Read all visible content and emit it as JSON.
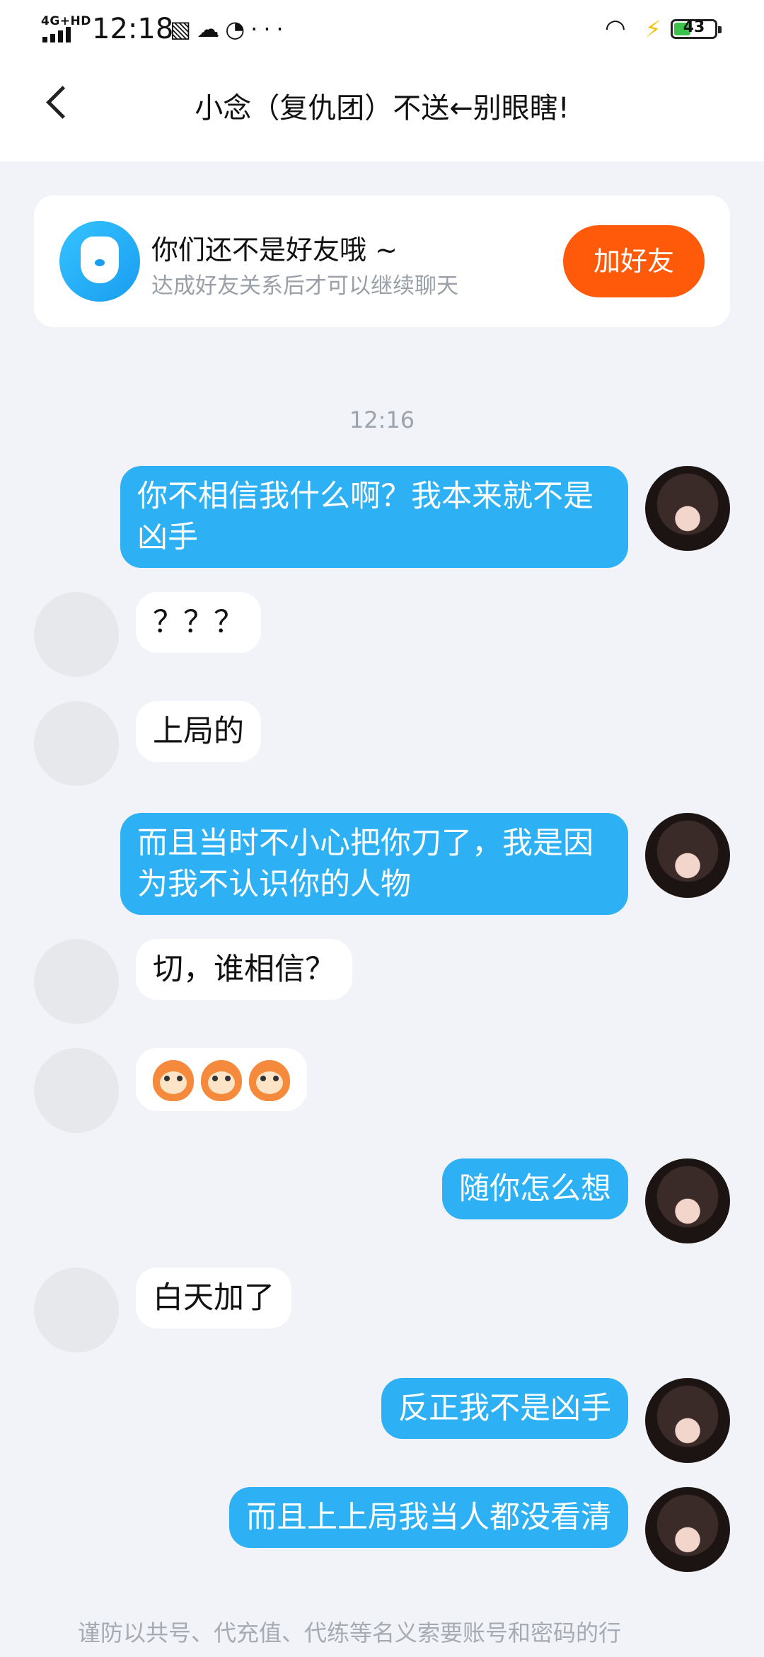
{
  "status_bar": {
    "network": "4G+HD",
    "time": "12:18",
    "icons": [
      "screenshot-icon",
      "cloud-icon",
      "compass-icon",
      "more-dots-icon"
    ],
    "icon_glyphs": "▧☁◔···",
    "battery": "43",
    "battery_level_percent": 43
  },
  "header": {
    "title": "小念（复仇团）不送←别眼瞎!"
  },
  "friend_card": {
    "headline": "你们还不是好友哦 ~",
    "subtext": "达成好友关系后才可以继续聊天",
    "button": "加好友"
  },
  "timestamp": "12:16",
  "messages": [
    {
      "side": "me",
      "text": "你不相信我什么啊？我本来就不是凶手"
    },
    {
      "side": "peer",
      "text": "？？？"
    },
    {
      "side": "peer",
      "text": "上局的"
    },
    {
      "side": "me",
      "text": "而且当时不小心把你刀了，我是因为我不认识你的人物"
    },
    {
      "side": "peer",
      "text": "切，谁相信？"
    },
    {
      "side": "peer",
      "emoji": "monkey-emoji x3"
    },
    {
      "side": "me",
      "text": "随你怎么想"
    },
    {
      "side": "peer",
      "text": "白天加了"
    },
    {
      "side": "me",
      "text": "反正我不是凶手"
    },
    {
      "side": "me",
      "text": "而且上上局我当人都没看清"
    }
  ],
  "footer": {
    "warning": "谨防以共号、代充值、代练等名义索要账号和密码的行"
  },
  "colors": {
    "accent_blue": "#2db1f4",
    "add_button": "#ff5a0a",
    "background": "#f1f3f8"
  }
}
